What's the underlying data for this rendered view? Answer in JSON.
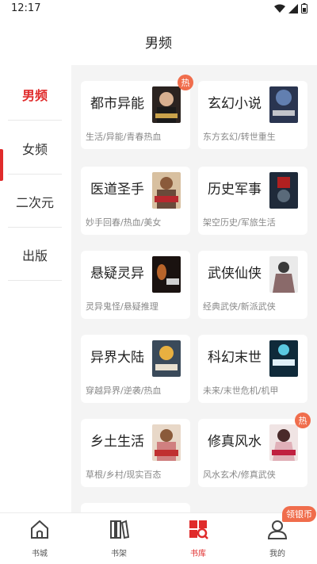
{
  "status": {
    "time": "12:17"
  },
  "header": {
    "title": "男频"
  },
  "sidebar": {
    "items": [
      {
        "label": "男频",
        "active": true
      },
      {
        "label": "女频",
        "active": false
      },
      {
        "label": "二次元",
        "active": false
      },
      {
        "label": "出版",
        "active": false
      }
    ]
  },
  "categories": [
    {
      "title": "都市异能",
      "tags": "生活/异能/青春热血",
      "hot": "热",
      "cover_color": "#2b2320",
      "cover_accent": "#c9a24a"
    },
    {
      "title": "玄幻小说",
      "tags": "东方玄幻/转世重生",
      "cover_color": "#2a3550",
      "cover_accent": "#7aa0d8"
    },
    {
      "title": "医道圣手",
      "tags": "妙手回春/热血/美女",
      "cover_color": "#d8c0a0",
      "cover_accent": "#b8282e"
    },
    {
      "title": "历史军事",
      "tags": "架空历史/军旅生活",
      "cover_color": "#1f2a3a",
      "cover_accent": "#e8e8e8"
    },
    {
      "title": "悬疑灵异",
      "tags": "灵异鬼怪/悬疑推理",
      "cover_color": "#1a1210",
      "cover_accent": "#b8642a"
    },
    {
      "title": "武侠仙侠",
      "tags": "经典武侠/新派武侠",
      "cover_color": "#eaeaea",
      "cover_accent": "#8a6a6a"
    },
    {
      "title": "异界大陆",
      "tags": "穿越异界/逆袭/热血",
      "cover_color": "#3a4a5a",
      "cover_accent": "#e8b040"
    },
    {
      "title": "科幻末世",
      "tags": "未来/末世危机/机甲",
      "cover_color": "#0f2a3a",
      "cover_accent": "#5ac8e0"
    },
    {
      "title": "乡土生活",
      "tags": "草根/乡村/现实百态",
      "cover_color": "#e8d8c8",
      "cover_accent": "#c03030"
    },
    {
      "title": "修真风水",
      "tags": "风水玄术/修真武侠",
      "hot": "热",
      "cover_color": "#f0e4e4",
      "cover_accent": "#c02040"
    }
  ],
  "tabbar": {
    "items": [
      {
        "label": "书城",
        "icon": "home-icon",
        "active": false
      },
      {
        "label": "书架",
        "icon": "bookshelf-icon",
        "active": false
      },
      {
        "label": "书库",
        "icon": "library-icon",
        "active": true
      },
      {
        "label": "我的",
        "icon": "profile-icon",
        "active": false
      }
    ],
    "badge": "领银币"
  },
  "colors": {
    "accent": "#e02b2b",
    "badge": "#f06d4c",
    "content_bg": "#f4f4f4"
  }
}
